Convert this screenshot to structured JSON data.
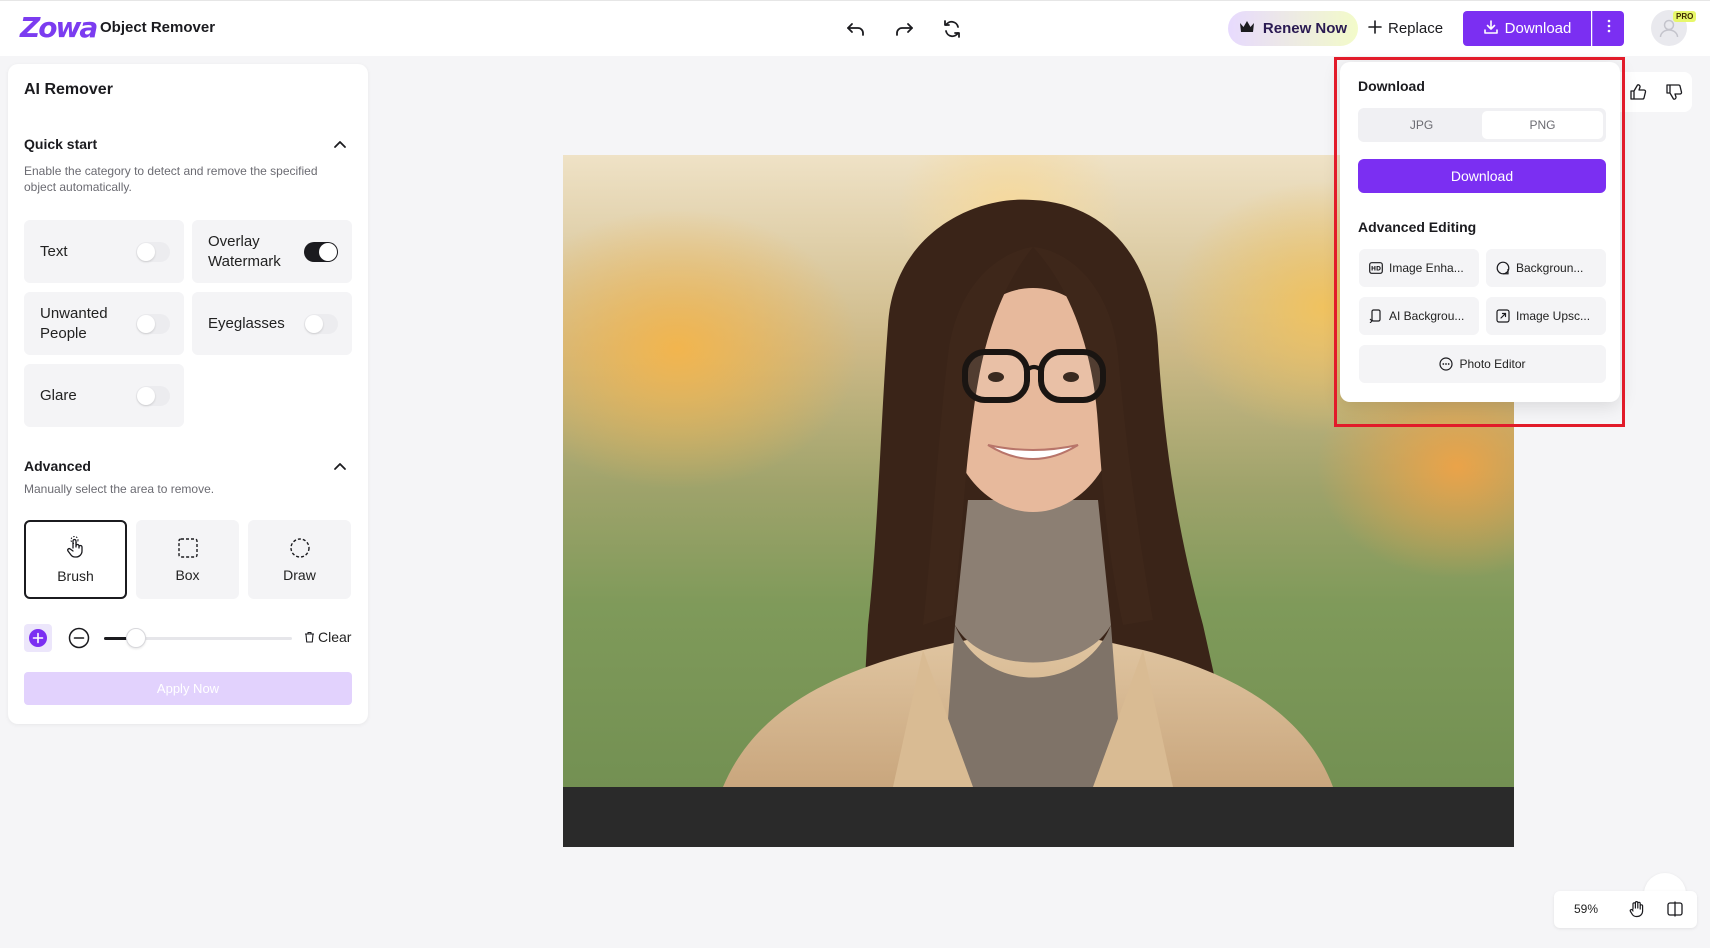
{
  "header": {
    "logo": "Zowa",
    "app_title": "Object Remover",
    "renew_label": "Renew Now",
    "replace_label": "Replace",
    "download_label": "Download",
    "pro_badge": "PRO"
  },
  "panel": {
    "title": "AI Remover",
    "quick_start": {
      "title": "Quick start",
      "description": "Enable the category to detect and remove the specified object automatically.",
      "categories": [
        {
          "label": "Text",
          "on": false
        },
        {
          "label": "Overlay Watermark",
          "on": true
        },
        {
          "label": "Unwanted People",
          "on": false
        },
        {
          "label": "Eyeglasses",
          "on": false
        },
        {
          "label": "Glare",
          "on": false
        }
      ]
    },
    "advanced": {
      "title": "Advanced",
      "description": "Manually select the area to remove.",
      "tools": [
        "Brush",
        "Box",
        "Draw"
      ],
      "selected_tool": "Brush"
    },
    "brush_size": 0.17,
    "clear_label": "Clear",
    "apply_label": "Apply Now"
  },
  "popover": {
    "title": "Download",
    "formats": [
      "JPG",
      "PNG"
    ],
    "selected_format": "PNG",
    "download_label": "Download",
    "advanced_title": "Advanced Editing",
    "advanced_items": [
      "Image Enha...",
      "Backgroun...",
      "AI Backgrou...",
      "Image Upsc..."
    ],
    "photo_editor_label": "Photo Editor"
  },
  "zoom": {
    "level": "59%"
  },
  "colors": {
    "accent": "#7b2ff2",
    "highlight_border": "#e21b2a",
    "dark": "#1b1b1f"
  }
}
